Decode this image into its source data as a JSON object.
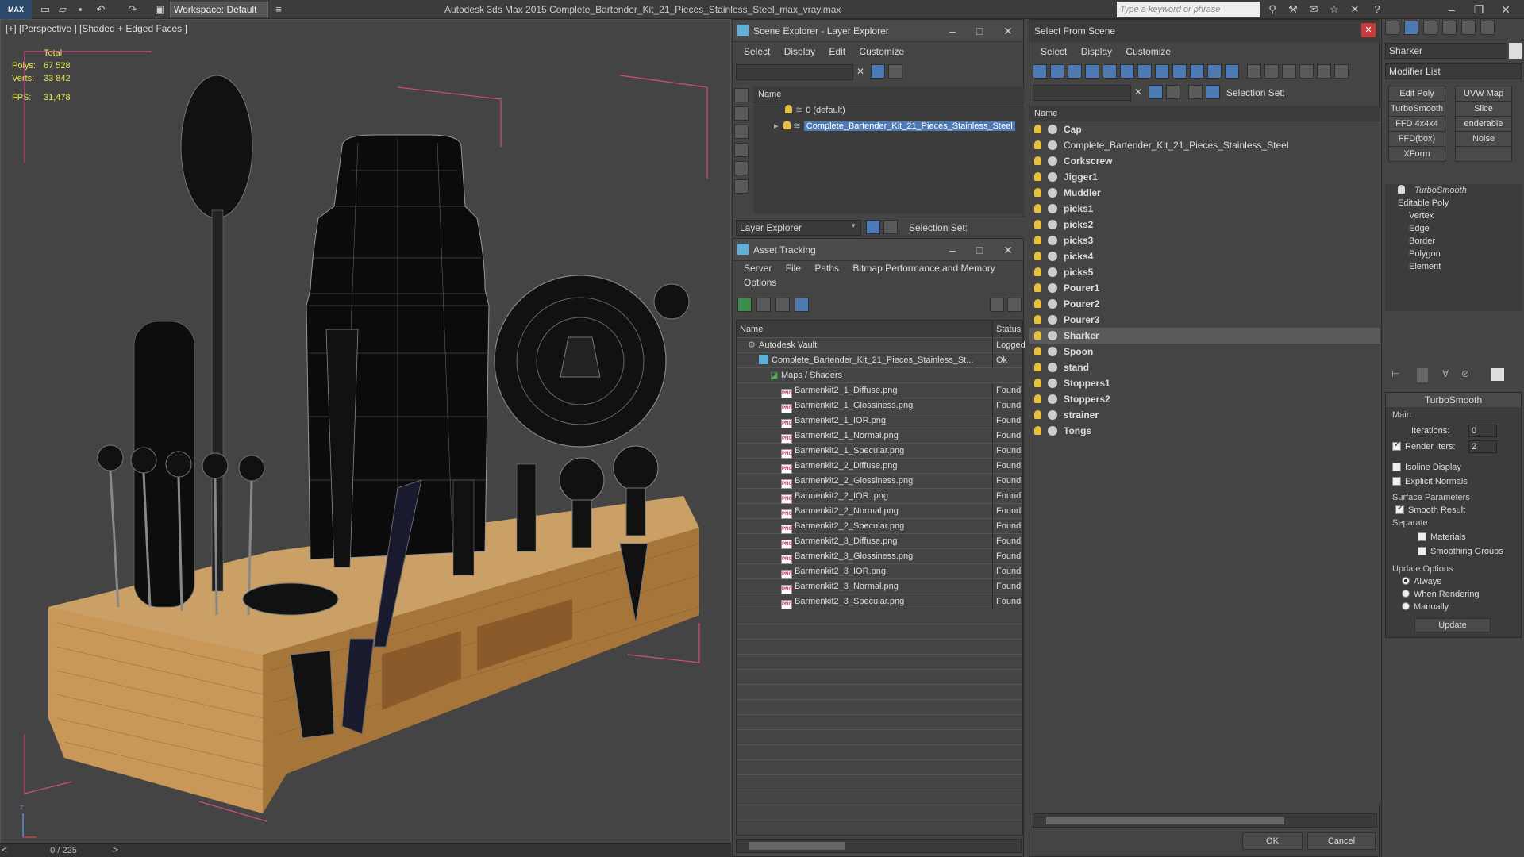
{
  "titlebar": {
    "logo": "MAX",
    "workspace": "Workspace: Default",
    "window_title": "Autodesk 3ds Max  2015      Complete_Bartender_Kit_21_Pieces_Stainless_Steel_max_vray.max",
    "search_placeholder": "Type a keyword or phrase"
  },
  "viewport": {
    "label": "[+] [Perspective ] [Shaded + Edged Faces ]",
    "stats": {
      "total_label": "Total",
      "polys_label": "Polys:",
      "polys": "67 528",
      "verts_label": "Verts:",
      "verts": "33 842",
      "fps_label": "FPS:",
      "fps": "31,478"
    },
    "frame_counter": "0 / 225"
  },
  "scene_explorer": {
    "title": "Scene Explorer - Layer Explorer",
    "menu": [
      "Select",
      "Display",
      "Edit",
      "Customize"
    ],
    "column_name": "Name",
    "layers": [
      "0 (default)",
      "Complete_Bartender_Kit_21_Pieces_Stainless_Steel"
    ],
    "bottom_combo": "Layer Explorer",
    "selection_set_label": "Selection Set:"
  },
  "asset_tracking": {
    "title": "Asset Tracking",
    "menu": [
      "Server",
      "File",
      "Paths",
      "Bitmap Performance and Memory"
    ],
    "menu2": "Options",
    "col_name": "Name",
    "col_status": "Status",
    "rows": [
      {
        "name": "Autodesk Vault",
        "status": "Logged",
        "level": 0,
        "kind": "vault"
      },
      {
        "name": "Complete_Bartender_Kit_21_Pieces_Stainless_St...",
        "status": "Ok",
        "level": 1,
        "kind": "max"
      },
      {
        "name": "Maps / Shaders",
        "status": "",
        "level": 2,
        "kind": "folder"
      },
      {
        "name": "Barmenkit2_1_Diffuse.png",
        "status": "Found",
        "level": 3,
        "kind": "png"
      },
      {
        "name": "Barmenkit2_1_Glossiness.png",
        "status": "Found",
        "level": 3,
        "kind": "png"
      },
      {
        "name": "Barmenkit2_1_IOR.png",
        "status": "Found",
        "level": 3,
        "kind": "png"
      },
      {
        "name": "Barmenkit2_1_Normal.png",
        "status": "Found",
        "level": 3,
        "kind": "png"
      },
      {
        "name": "Barmenkit2_1_Specular.png",
        "status": "Found",
        "level": 3,
        "kind": "png"
      },
      {
        "name": "Barmenkit2_2_Diffuse.png",
        "status": "Found",
        "level": 3,
        "kind": "png"
      },
      {
        "name": "Barmenkit2_2_Glossiness.png",
        "status": "Found",
        "level": 3,
        "kind": "png"
      },
      {
        "name": "Barmenkit2_2_IOR .png",
        "status": "Found",
        "level": 3,
        "kind": "png"
      },
      {
        "name": "Barmenkit2_2_Normal.png",
        "status": "Found",
        "level": 3,
        "kind": "png"
      },
      {
        "name": "Barmenkit2_2_Specular.png",
        "status": "Found",
        "level": 3,
        "kind": "png"
      },
      {
        "name": "Barmenkit2_3_Diffuse.png",
        "status": "Found",
        "level": 3,
        "kind": "png"
      },
      {
        "name": "Barmenkit2_3_Glossiness.png",
        "status": "Found",
        "level": 3,
        "kind": "png"
      },
      {
        "name": "Barmenkit2_3_IOR.png",
        "status": "Found",
        "level": 3,
        "kind": "png"
      },
      {
        "name": "Barmenkit2_3_Normal.png",
        "status": "Found",
        "level": 3,
        "kind": "png"
      },
      {
        "name": "Barmenkit2_3_Specular.png",
        "status": "Found",
        "level": 3,
        "kind": "png"
      }
    ]
  },
  "select_from_scene": {
    "title": "Select From Scene",
    "menu": [
      "Select",
      "Display",
      "Customize"
    ],
    "selection_set_label": "Selection Set:",
    "column_name": "Name",
    "objects": [
      {
        "name": "Cap",
        "bold": true
      },
      {
        "name": "Complete_Bartender_Kit_21_Pieces_Stainless_Steel",
        "bold": false
      },
      {
        "name": "Corkscrew",
        "bold": true
      },
      {
        "name": "Jigger1",
        "bold": true
      },
      {
        "name": "Muddler",
        "bold": true
      },
      {
        "name": "picks1",
        "bold": true
      },
      {
        "name": "picks2",
        "bold": true
      },
      {
        "name": "picks3",
        "bold": true
      },
      {
        "name": "picks4",
        "bold": true
      },
      {
        "name": "picks5",
        "bold": true
      },
      {
        "name": "Pourer1",
        "bold": true
      },
      {
        "name": "Pourer2",
        "bold": true
      },
      {
        "name": "Pourer3",
        "bold": true
      },
      {
        "name": "Sharker",
        "bold": true,
        "highlighted": true
      },
      {
        "name": "Spoon",
        "bold": true
      },
      {
        "name": "stand",
        "bold": true
      },
      {
        "name": "Stoppers1",
        "bold": true
      },
      {
        "name": "Stoppers2",
        "bold": true
      },
      {
        "name": "strainer",
        "bold": true
      },
      {
        "name": "Tongs",
        "bold": true
      }
    ],
    "ok": "OK",
    "cancel": "Cancel"
  },
  "command_panel": {
    "object_name": "Sharker",
    "modifier_list": "Modifier List",
    "buttons": [
      "Edit Poly",
      "UVW Map",
      "TurboSmooth",
      "Slice",
      "FFD 4x4x4",
      "enderable Splir",
      "FFD(box)",
      "Noise",
      "XForm",
      ""
    ],
    "stack": [
      "TurboSmooth",
      "Editable Poly",
      "Vertex",
      "Edge",
      "Border",
      "Polygon",
      "Element"
    ],
    "rollout_title": "TurboSmooth",
    "main_label": "Main",
    "iterations_label": "Iterations:",
    "iterations": "0",
    "render_iters_label": "Render Iters:",
    "render_iters": "2",
    "isoline": "Isoline Display",
    "explicit_normals": "Explicit Normals",
    "surface_params": "Surface Parameters",
    "smooth_result": "Smooth Result",
    "separate": "Separate",
    "materials": "Materials",
    "smoothing_groups": "Smoothing Groups",
    "update_options": "Update Options",
    "always": "Always",
    "when_rendering": "When Rendering",
    "manually": "Manually",
    "update": "Update"
  }
}
